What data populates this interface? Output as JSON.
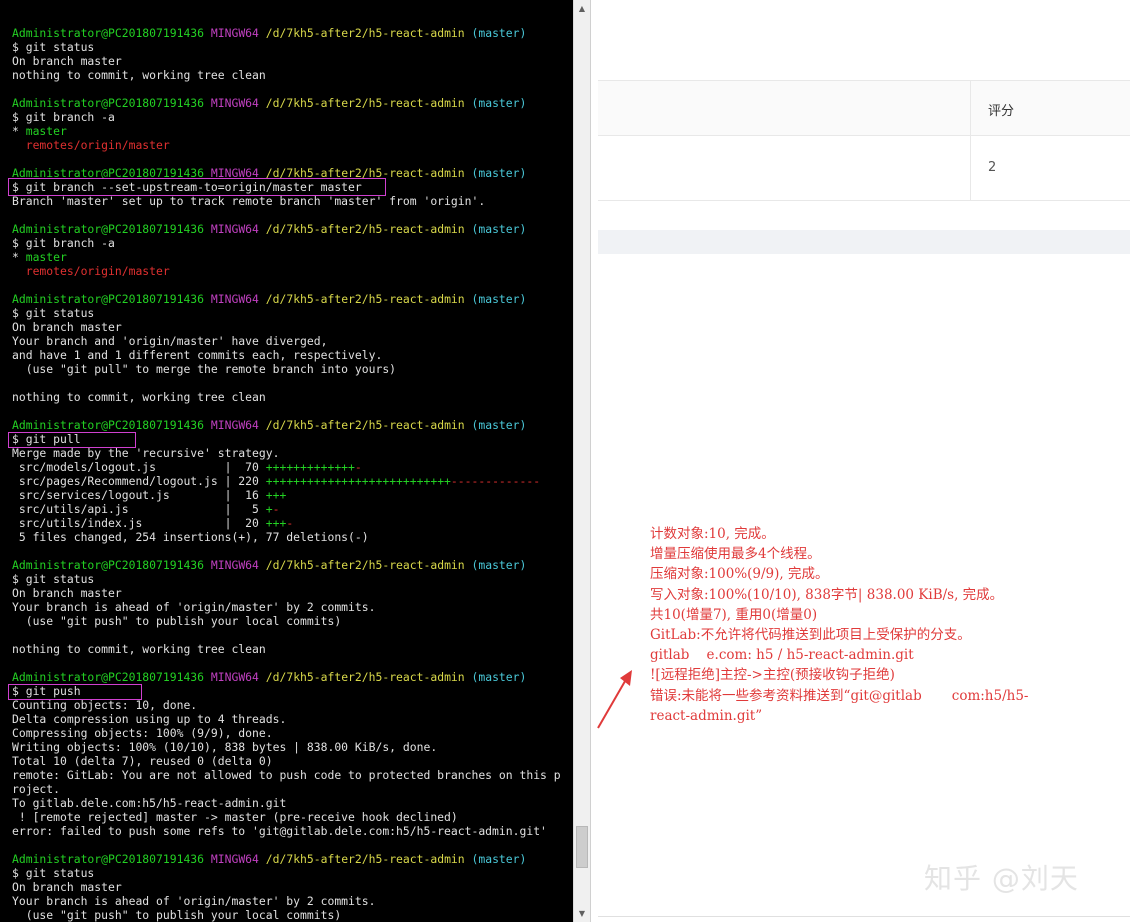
{
  "terminal": {
    "lines": [
      [
        {
          "t": "Administrator@PC201807191436",
          "c": "g"
        },
        {
          "t": " MINGW64",
          "c": "m"
        },
        {
          "t": " /d/7kh5-after2/h5-react-admin",
          "c": "y"
        },
        {
          "t": " (master)",
          "c": "c"
        }
      ],
      [
        {
          "t": "$ git status",
          "c": "w"
        }
      ],
      [
        {
          "t": "On branch master",
          "c": "w"
        }
      ],
      [
        {
          "t": "nothing to commit, working tree clean",
          "c": "w"
        }
      ],
      [],
      [
        {
          "t": "Administrator@PC201807191436",
          "c": "g"
        },
        {
          "t": " MINGW64",
          "c": "m"
        },
        {
          "t": " /d/7kh5-after2/h5-react-admin",
          "c": "y"
        },
        {
          "t": " (master)",
          "c": "c"
        }
      ],
      [
        {
          "t": "$ git branch -a",
          "c": "w"
        }
      ],
      [
        {
          "t": "* ",
          "c": "w"
        },
        {
          "t": "master",
          "c": "g"
        }
      ],
      [
        {
          "t": "  remotes/origin/master",
          "c": "r"
        }
      ],
      [],
      [
        {
          "t": "Administrator@PC201807191436",
          "c": "g"
        },
        {
          "t": " MINGW64",
          "c": "m"
        },
        {
          "t": " /d/7kh5-after2/h5-react-admin",
          "c": "y"
        },
        {
          "t": " (master)",
          "c": "c"
        }
      ],
      [
        {
          "t": "$ git branch --set-upstream-to=origin/master master",
          "c": "w"
        }
      ],
      [
        {
          "t": "Branch 'master' set up to track remote branch 'master' from 'origin'.",
          "c": "w"
        }
      ],
      [],
      [
        {
          "t": "Administrator@PC201807191436",
          "c": "g"
        },
        {
          "t": " MINGW64",
          "c": "m"
        },
        {
          "t": " /d/7kh5-after2/h5-react-admin",
          "c": "y"
        },
        {
          "t": " (master)",
          "c": "c"
        }
      ],
      [
        {
          "t": "$ git branch -a",
          "c": "w"
        }
      ],
      [
        {
          "t": "* ",
          "c": "w"
        },
        {
          "t": "master",
          "c": "g"
        }
      ],
      [
        {
          "t": "  remotes/origin/master",
          "c": "r"
        }
      ],
      [],
      [
        {
          "t": "Administrator@PC201807191436",
          "c": "g"
        },
        {
          "t": " MINGW64",
          "c": "m"
        },
        {
          "t": " /d/7kh5-after2/h5-react-admin",
          "c": "y"
        },
        {
          "t": " (master)",
          "c": "c"
        }
      ],
      [
        {
          "t": "$ git status",
          "c": "w"
        }
      ],
      [
        {
          "t": "On branch master",
          "c": "w"
        }
      ],
      [
        {
          "t": "Your branch and 'origin/master' have diverged,",
          "c": "w"
        }
      ],
      [
        {
          "t": "and have 1 and 1 different commits each, respectively.",
          "c": "w"
        }
      ],
      [
        {
          "t": "  (use \"git pull\" to merge the remote branch into yours)",
          "c": "w"
        }
      ],
      [],
      [
        {
          "t": "nothing to commit, working tree clean",
          "c": "w"
        }
      ],
      [],
      [
        {
          "t": "Administrator@PC201807191436",
          "c": "g"
        },
        {
          "t": " MINGW64",
          "c": "m"
        },
        {
          "t": " /d/7kh5-after2/h5-react-admin",
          "c": "y"
        },
        {
          "t": " (master)",
          "c": "c"
        }
      ],
      [
        {
          "t": "$ git pull",
          "c": "w"
        }
      ],
      [
        {
          "t": "Merge made by the 'recursive' strategy.",
          "c": "w"
        }
      ],
      [
        {
          "t": " src/models/logout.js          |  70 ",
          "c": "w"
        },
        {
          "t": "+++++++++++++",
          "c": "g"
        },
        {
          "t": "-",
          "c": "r"
        }
      ],
      [
        {
          "t": " src/pages/Recommend/logout.js | 220 ",
          "c": "w"
        },
        {
          "t": "+++++++++++++++++++++++++++",
          "c": "g"
        },
        {
          "t": "-------------",
          "c": "r"
        }
      ],
      [
        {
          "t": " src/services/logout.js        |  16 ",
          "c": "w"
        },
        {
          "t": "+++",
          "c": "g"
        }
      ],
      [
        {
          "t": " src/utils/api.js              |   5 ",
          "c": "w"
        },
        {
          "t": "+",
          "c": "g"
        },
        {
          "t": "-",
          "c": "r"
        }
      ],
      [
        {
          "t": " src/utils/index.js            |  20 ",
          "c": "w"
        },
        {
          "t": "+++",
          "c": "g"
        },
        {
          "t": "-",
          "c": "r"
        }
      ],
      [
        {
          "t": " 5 files changed, 254 insertions(+), 77 deletions(-)",
          "c": "w"
        }
      ],
      [],
      [
        {
          "t": "Administrator@PC201807191436",
          "c": "g"
        },
        {
          "t": " MINGW64",
          "c": "m"
        },
        {
          "t": " /d/7kh5-after2/h5-react-admin",
          "c": "y"
        },
        {
          "t": " (master)",
          "c": "c"
        }
      ],
      [
        {
          "t": "$ git status",
          "c": "w"
        }
      ],
      [
        {
          "t": "On branch master",
          "c": "w"
        }
      ],
      [
        {
          "t": "Your branch is ahead of 'origin/master' by 2 commits.",
          "c": "w"
        }
      ],
      [
        {
          "t": "  (use \"git push\" to publish your local commits)",
          "c": "w"
        }
      ],
      [],
      [
        {
          "t": "nothing to commit, working tree clean",
          "c": "w"
        }
      ],
      [],
      [
        {
          "t": "Administrator@PC201807191436",
          "c": "g"
        },
        {
          "t": " MINGW64",
          "c": "m"
        },
        {
          "t": " /d/7kh5-after2/h5-react-admin",
          "c": "y"
        },
        {
          "t": " (master)",
          "c": "c"
        }
      ],
      [
        {
          "t": "$ git push",
          "c": "w"
        }
      ],
      [
        {
          "t": "Counting objects: 10, done.",
          "c": "w"
        }
      ],
      [
        {
          "t": "Delta compression using up to 4 threads.",
          "c": "w"
        }
      ],
      [
        {
          "t": "Compressing objects: 100% (9/9), done.",
          "c": "w"
        }
      ],
      [
        {
          "t": "Writing objects: 100% (10/10), 838 bytes | 838.00 KiB/s, done.",
          "c": "w"
        }
      ],
      [
        {
          "t": "Total 10 (delta 7), reused 0 (delta 0)",
          "c": "w"
        }
      ],
      [
        {
          "t": "remote: GitLab: You are not allowed to push code to protected branches on this p",
          "c": "w"
        }
      ],
      [
        {
          "t": "roject.",
          "c": "w"
        }
      ],
      [
        {
          "t": "To gitlab.dele.com:h5/h5-react-admin.git",
          "c": "w"
        }
      ],
      [
        {
          "t": " ! [remote rejected] master -> master (pre-receive hook declined)",
          "c": "w"
        }
      ],
      [
        {
          "t": "error: failed to push some refs to 'git@gitlab.dele.com:h5/h5-react-admin.git'",
          "c": "w"
        }
      ],
      [],
      [
        {
          "t": "Administrator@PC201807191436",
          "c": "g"
        },
        {
          "t": " MINGW64",
          "c": "m"
        },
        {
          "t": " /d/7kh5-after2/h5-react-admin",
          "c": "y"
        },
        {
          "t": " (master)",
          "c": "c"
        }
      ],
      [
        {
          "t": "$ git status",
          "c": "w"
        }
      ],
      [
        {
          "t": "On branch master",
          "c": "w"
        }
      ],
      [
        {
          "t": "Your branch is ahead of 'origin/master' by 2 commits.",
          "c": "w"
        }
      ],
      [
        {
          "t": "  (use \"git push\" to publish your local commits)",
          "c": "w"
        }
      ]
    ]
  },
  "table": {
    "header_score": "评分",
    "row_score": "2"
  },
  "annotation": {
    "text": "计数对象:10, 完成。\n增量压缩使用最多4个线程。\n压缩对象:100%(9/9), 完成。\n写入对象:100%(10/10), 838字节| 838.00 KiB/s, 完成。\n共10(增量7), 重用0(增量0)\nGitLab:不允许将代码推送到此项目上受保护的分支。\ngitlab    e.com: h5 / h5-react-admin.git\n![远程拒绝]主控->主控(预接收钩子拒绝)\n错误:未能将一些参考资料推送到“git@gitlab       com:h5/h5-\nreact-admin.git”",
    "color": "#e03a3a"
  },
  "watermark": "知乎 @刘天",
  "colors": {
    "terminal_bg": "#000000",
    "prompt_green": "#23d023",
    "prompt_magenta": "#c040c0",
    "path_yellow": "#d8d84a",
    "branch_cyan": "#4ac8d8",
    "highlight_box": "#d040d0"
  }
}
